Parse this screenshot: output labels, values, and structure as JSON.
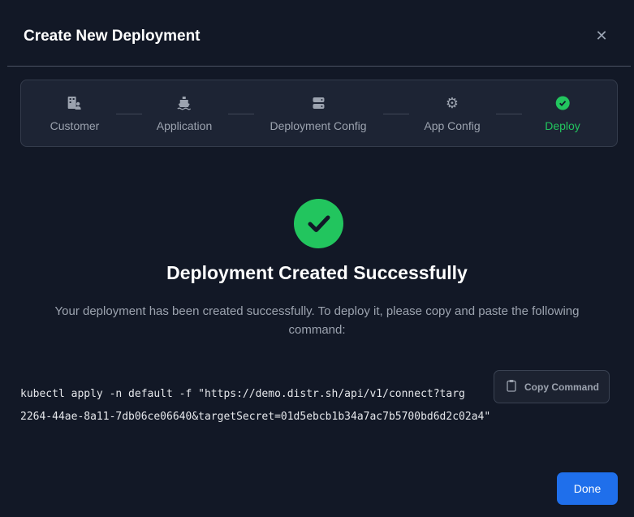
{
  "dialog": {
    "title": "Create New Deployment",
    "close_icon": "close-icon"
  },
  "steps": [
    {
      "label": "Customer",
      "icon": "building-user-icon",
      "state": "done"
    },
    {
      "label": "Application",
      "icon": "ship-icon",
      "state": "done"
    },
    {
      "label": "Deployment Config",
      "icon": "server-icon",
      "state": "done"
    },
    {
      "label": "App Config",
      "icon": "gear-icon",
      "state": "done"
    },
    {
      "label": "Deploy",
      "icon": "check-circle-icon",
      "state": "active"
    }
  ],
  "success": {
    "heading": "Deployment Created Successfully",
    "description": "Your deployment has been created successfully. To deploy it, please copy and paste the following command:",
    "command_line1": "kubectl apply -n default -f \"https://demo.distr.sh/api/v1/connect?targ",
    "command_line2": "2264-44ae-8a11-7db06ce06640&targetSecret=01d5ebcb1b34a7ac7b5700bd6d2c02a4\"",
    "copy_label": "Copy Command"
  },
  "footer": {
    "done_label": "Done"
  },
  "colors": {
    "accent": "#1f6feb",
    "success": "#22c55e",
    "background": "#121826"
  }
}
